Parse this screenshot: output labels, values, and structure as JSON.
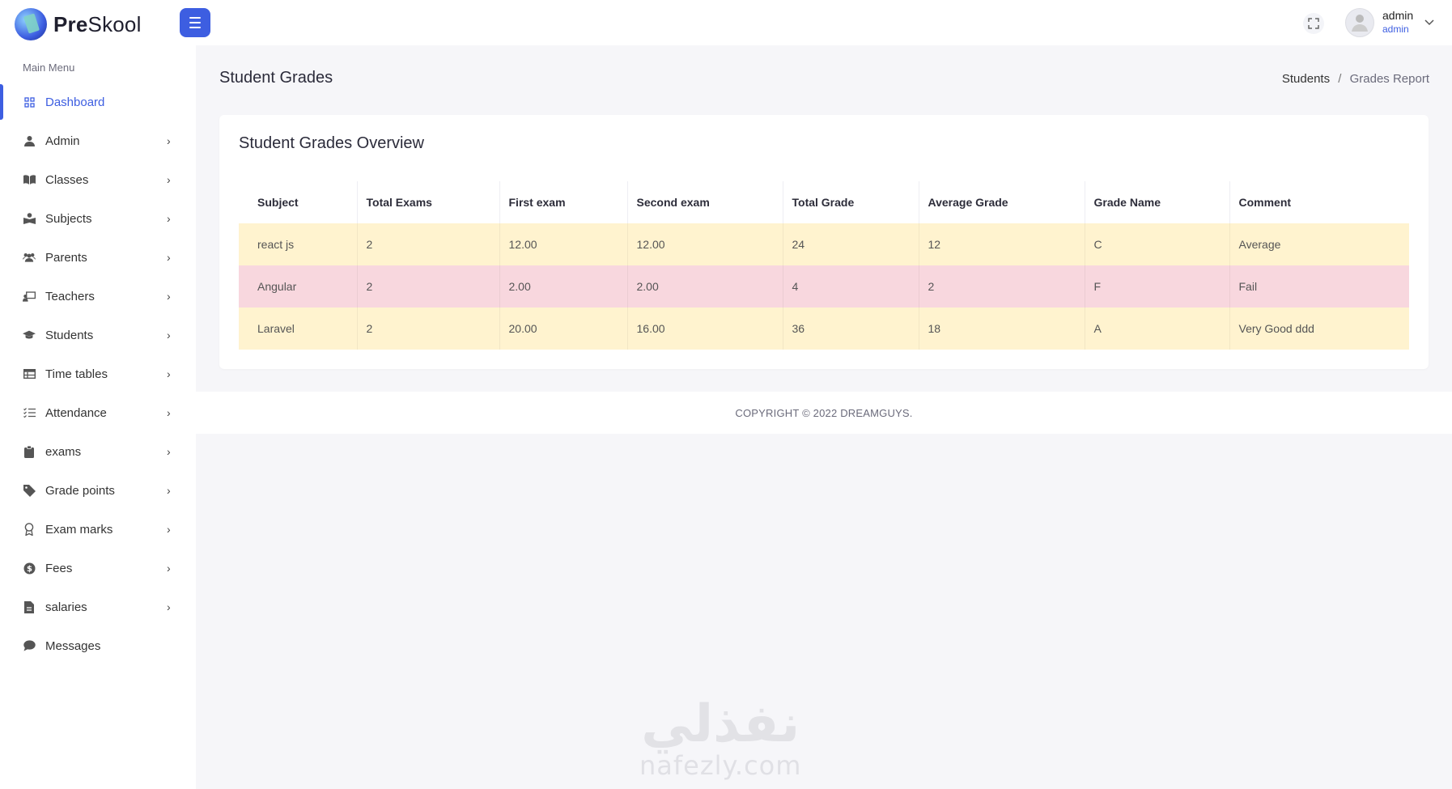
{
  "app": {
    "brand_bold": "Pre",
    "brand_rest": "Skool"
  },
  "header": {
    "user_name": "admin",
    "user_role": "admin"
  },
  "sidebar": {
    "title": "Main Menu",
    "items": [
      {
        "label": "Dashboard",
        "icon": "grid-icon",
        "active": true
      },
      {
        "label": "Admin",
        "icon": "user-tie-icon"
      },
      {
        "label": "Classes",
        "icon": "book-open-icon"
      },
      {
        "label": "Subjects",
        "icon": "book-reader-icon"
      },
      {
        "label": "Parents",
        "icon": "users-icon"
      },
      {
        "label": "Teachers",
        "icon": "chalkboard-teacher-icon"
      },
      {
        "label": "Students",
        "icon": "graduation-cap-icon"
      },
      {
        "label": "Time tables",
        "icon": "table-icon"
      },
      {
        "label": "Attendance",
        "icon": "list-check-icon"
      },
      {
        "label": "exams",
        "icon": "clipboard-icon"
      },
      {
        "label": "Grade points",
        "icon": "tag-icon"
      },
      {
        "label": "Exam marks",
        "icon": "award-icon"
      },
      {
        "label": "Fees",
        "icon": "dollar-icon"
      },
      {
        "label": "salaries",
        "icon": "file-invoice-icon"
      },
      {
        "label": "Messages",
        "icon": "comment-icon"
      }
    ]
  },
  "page": {
    "title": "Student Grades",
    "breadcrumb_parent": "Students",
    "breadcrumb_separator": "/",
    "breadcrumb_current": "Grades Report"
  },
  "card": {
    "title": "Student Grades Overview",
    "columns": [
      "Subject",
      "Total Exams",
      "First exam",
      "Second exam",
      "Total Grade",
      "Average Grade",
      "Grade Name",
      "Comment"
    ],
    "rows": [
      {
        "status": "warning",
        "cells": [
          "react js",
          "2",
          "12.00",
          "12.00",
          "24",
          "12",
          "C",
          "Average"
        ]
      },
      {
        "status": "danger",
        "cells": [
          "Angular",
          "2",
          "2.00",
          "2.00",
          "4",
          "2",
          "F",
          "Fail"
        ]
      },
      {
        "status": "warning",
        "cells": [
          "Laravel",
          "2",
          "20.00",
          "16.00",
          "36",
          "18",
          "A",
          "Very Good ddd"
        ]
      }
    ]
  },
  "footer": {
    "copyright": "COPYRIGHT © 2022 DREAMGUYS."
  },
  "watermark": {
    "arabic": "نفذلي",
    "latin": "nafezly.com"
  },
  "colors": {
    "primary": "#3d5ee1",
    "warning_row": "#fff3cf",
    "danger_row": "#f8d7de",
    "background": "#f6f6f9"
  }
}
